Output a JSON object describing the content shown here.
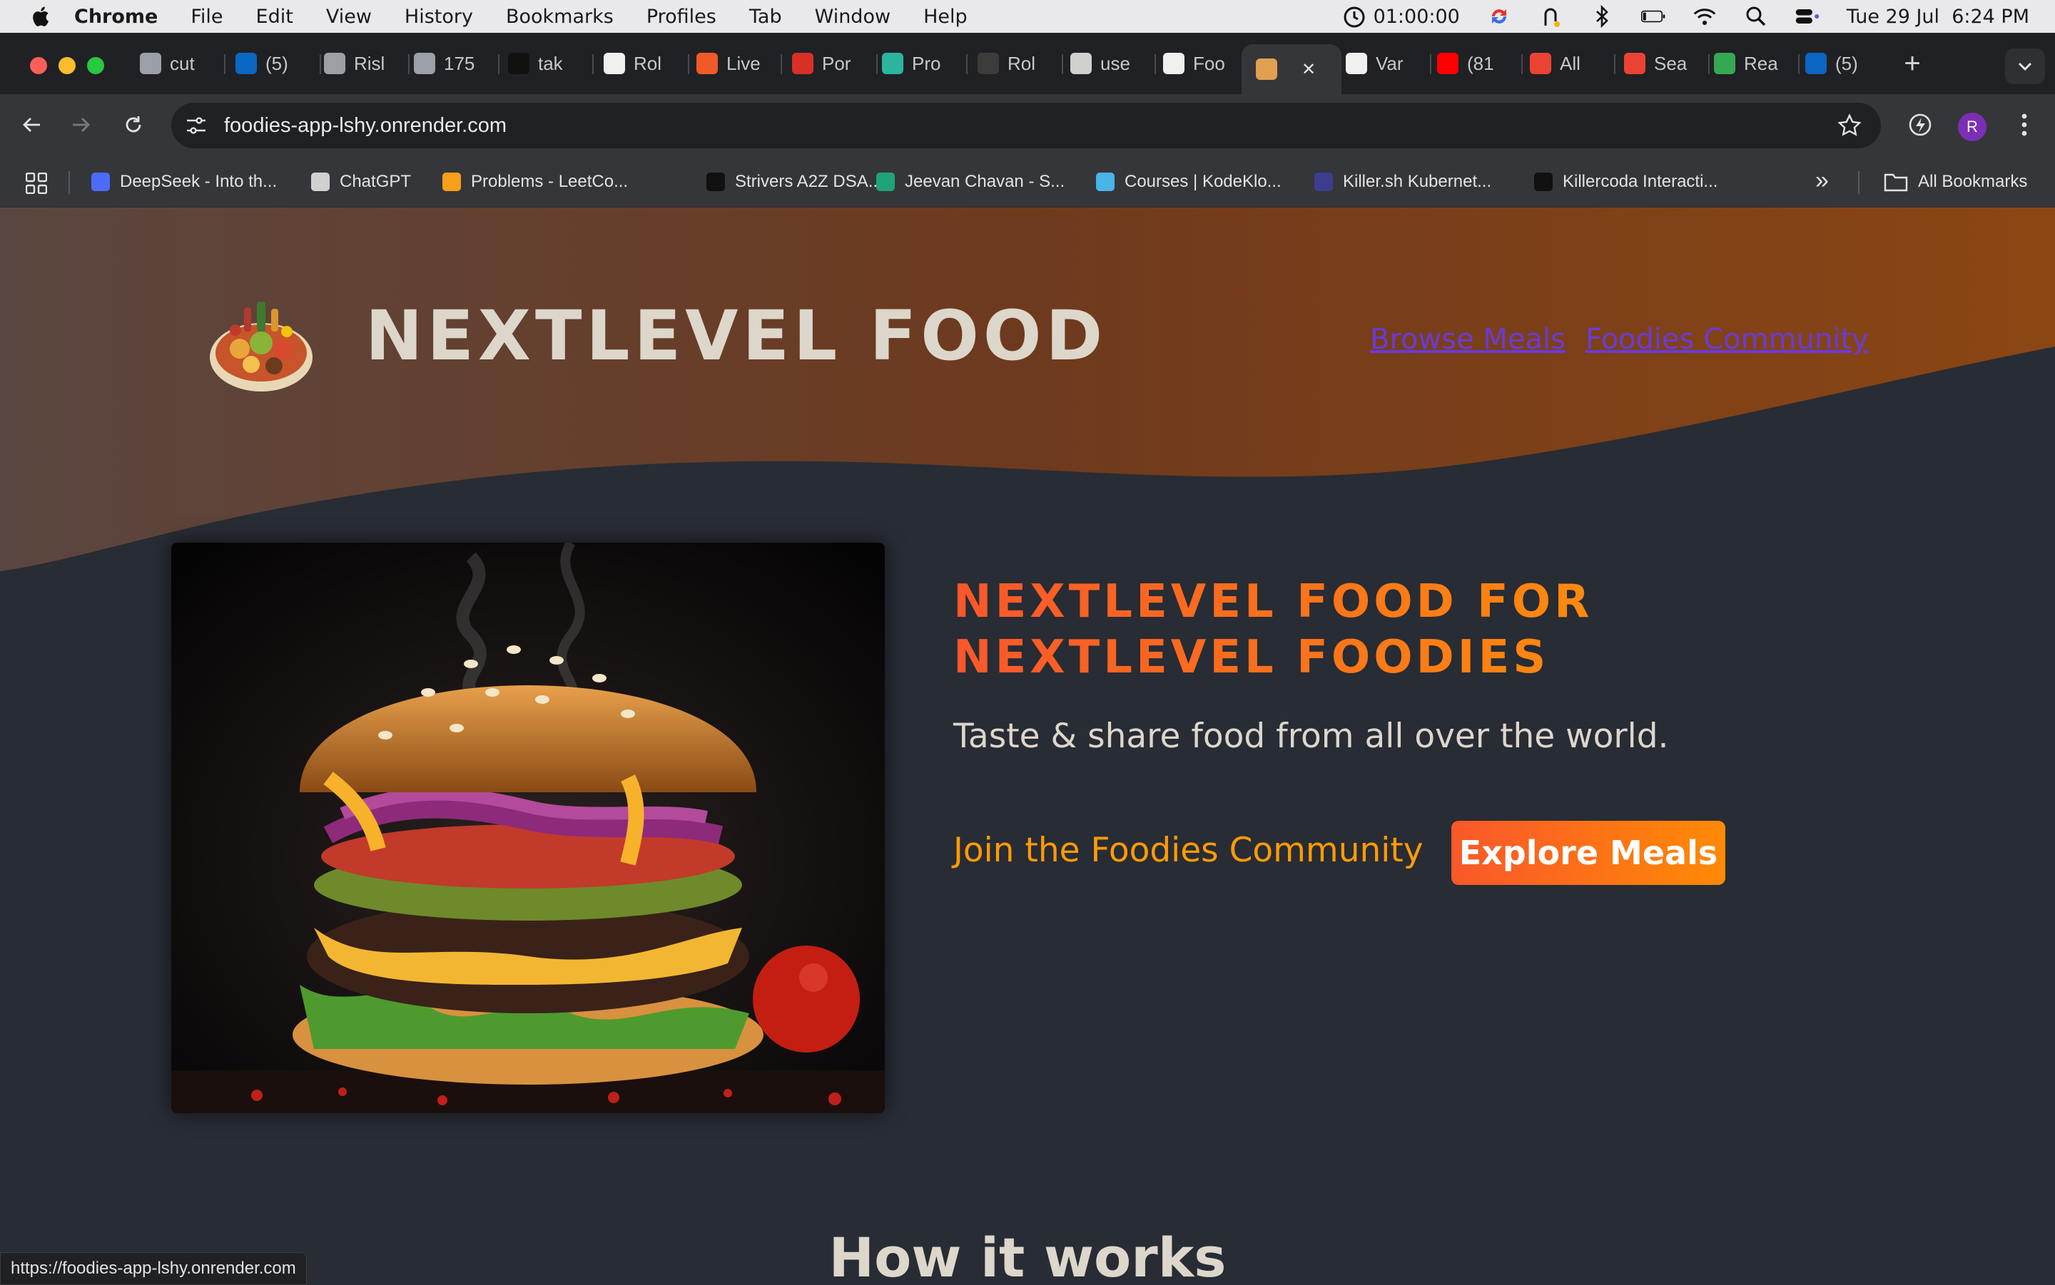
{
  "menubar": {
    "app_name": "Chrome",
    "menus": [
      "File",
      "Edit",
      "View",
      "History",
      "Bookmarks",
      "Profiles",
      "Tab",
      "Window",
      "Help"
    ],
    "timer": "01:00:00",
    "datetime": "Tue 29 Jul  6:24 PM"
  },
  "tabs": [
    {
      "label": "cut",
      "icon_color": "#9aa0a6"
    },
    {
      "label": "(5)",
      "icon_color": "#0a66c2"
    },
    {
      "label": "Risl",
      "icon_color": "#9aa0a6"
    },
    {
      "label": "175",
      "icon_color": "#9aa0a6"
    },
    {
      "label": "tak",
      "icon_color": "#111111"
    },
    {
      "label": "Rol",
      "icon_color": "#f0f0f0"
    },
    {
      "label": "Live",
      "icon_color": "#f05a28"
    },
    {
      "label": "Por",
      "icon_color": "#d93025"
    },
    {
      "label": "Pro",
      "icon_color": "#2bb5a0"
    },
    {
      "label": "Rol",
      "icon_color": "#3c3c3c"
    },
    {
      "label": "use",
      "icon_color": "#d0d0d0"
    },
    {
      "label": "Foo",
      "icon_color": "#f0f0f0"
    },
    {
      "label": "",
      "icon_color": "#e0a050",
      "active": true
    },
    {
      "label": "Var",
      "icon_color": "#f0f0f0"
    },
    {
      "label": "(81",
      "icon_color": "#ff0000"
    },
    {
      "label": "All",
      "icon_color": "#ea4335"
    },
    {
      "label": "Sea",
      "icon_color": "#ea4335"
    },
    {
      "label": "Rea",
      "icon_color": "#34a853"
    },
    {
      "label": "(5)",
      "icon_color": "#0a66c2"
    }
  ],
  "toolbar": {
    "url": "foodies-app-lshy.onrender.com",
    "avatar_letter": "R"
  },
  "bookmarks": [
    {
      "label": "DeepSeek - Into th...",
      "icon_color": "#4d6bfe"
    },
    {
      "label": "ChatGPT",
      "icon_color": "#d0d0d0"
    },
    {
      "label": "Problems - LeetCo...",
      "icon_color": "#f89f1b"
    },
    {
      "label": "Strivers A2Z DSA...",
      "icon_color": "#111111"
    },
    {
      "label": "Jeevan Chavan - S...",
      "icon_color": "#1fa37a"
    },
    {
      "label": "Courses | KodeKlo...",
      "icon_color": "#4ab3e8"
    },
    {
      "label": "Killer.sh Kubernet...",
      "icon_color": "#3d3d8f"
    },
    {
      "label": "Killercoda Interacti...",
      "icon_color": "#111111"
    }
  ],
  "bookmarks_more": "»",
  "all_bookmarks": "All Bookmarks",
  "page": {
    "logo_text": "NEXTLEVEL FOOD",
    "nav": [
      "Browse Meals",
      "Foodies Community"
    ],
    "hero_title": "NEXTLEVEL FOOD FOR NEXTLEVEL FOODIES",
    "hero_subtitle": "Taste & share food from all over the world.",
    "cta_link": "Join the Foodies Community",
    "cta_button": "Explore Meals",
    "section_title": "How it works"
  },
  "status_bar_url": "https://foodies-app-lshy.onrender.com",
  "colors": {
    "accent_start": "#f9572a",
    "accent_end": "#ff9b05",
    "page_bg": "#282c34",
    "header_brown": "#8a4a1c"
  }
}
